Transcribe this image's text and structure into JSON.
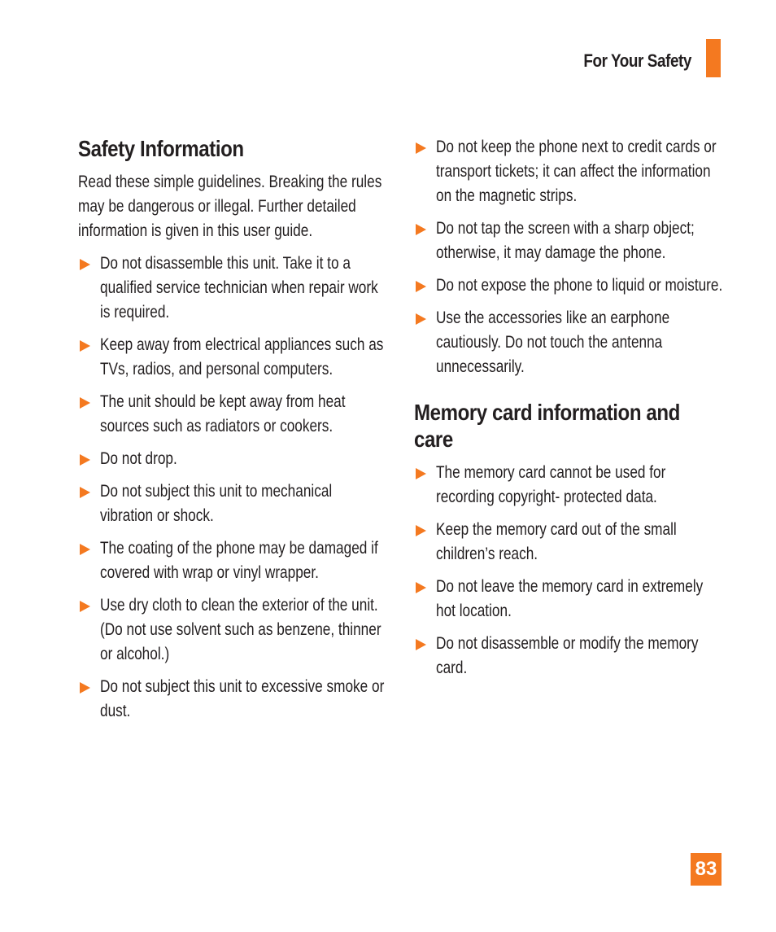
{
  "header": {
    "title": "For Your Safety",
    "accent_color": "#f47920"
  },
  "safety": {
    "title": "Safety Information",
    "intro": "Read these simple guidelines. Breaking the rules may be dangerous or illegal. Further detailed information is given in this user guide.",
    "items": [
      "Do not disassemble this unit. Take it to a qualified service technician when repair work is required.",
      "Keep away from electrical appliances such as TVs, radios, and personal computers.",
      "The unit should be kept away from heat sources such as radiators or cookers.",
      "Do not drop.",
      "Do not subject this unit to mechanical vibration or shock.",
      "The coating of the phone may be damaged if covered with wrap or vinyl wrapper.",
      "Use dry cloth to clean the exterior of the unit. (Do not use solvent such as benzene, thinner or alcohol.)",
      "Do not subject this unit to excessive smoke or dust."
    ],
    "items_continued": [
      "Do not keep the phone next to credit cards or transport tickets; it can affect the information on the magnetic strips.",
      "Do not tap the screen with a sharp object; otherwise, it may damage the phone.",
      "Do not expose the phone to liquid or moisture.",
      "Use the accessories like an earphone cautiously. Do not touch the antenna unnecessarily."
    ]
  },
  "memory": {
    "title": "Memory card information and care",
    "items": [
      "The memory card cannot be used for recording copyright- protected data.",
      "Keep the memory card out of the small children’s reach.",
      "Do not leave the memory card in extremely hot location.",
      "Do not disassemble or modify the memory card."
    ]
  },
  "page_number": "83"
}
